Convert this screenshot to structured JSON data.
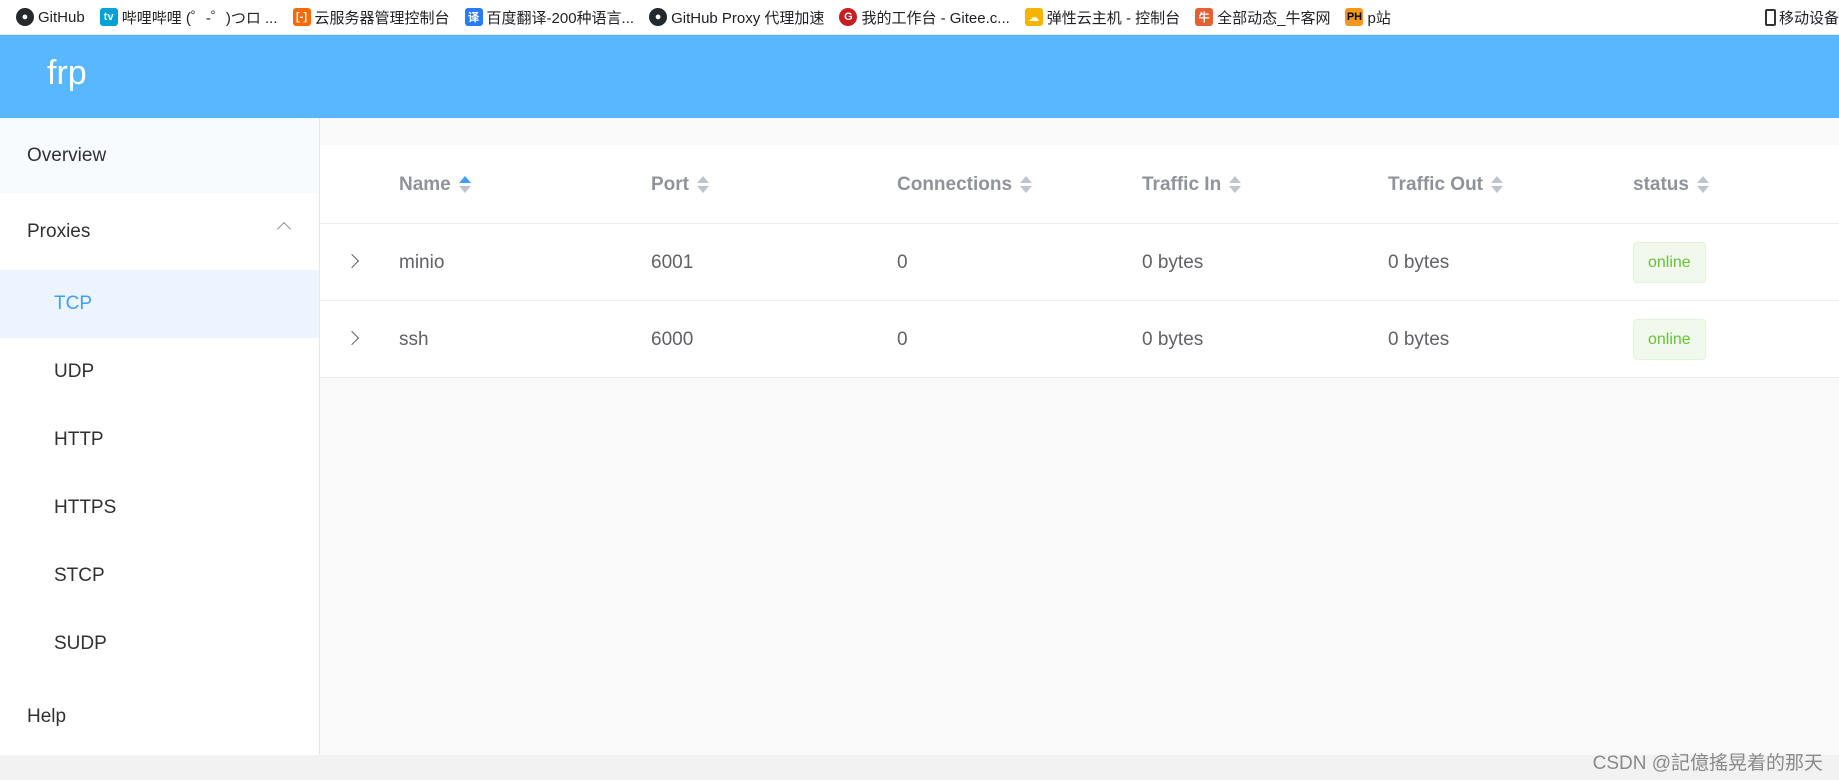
{
  "bookmarks": [
    {
      "label": "GitHub",
      "icon": "github-icon",
      "color": "#24292e"
    },
    {
      "label": "哔哩哔哩 (゜-゜)つロ ...",
      "icon": "bilibili-icon",
      "color": "#00a1d6"
    },
    {
      "label": "云服务器管理控制台",
      "icon": "aliyun-icon",
      "color": "#ff6a00"
    },
    {
      "label": "百度翻译-200种语言...",
      "icon": "baidu-translate-icon",
      "color": "#2a7bf7"
    },
    {
      "label": "GitHub Proxy 代理加速",
      "icon": "github-icon",
      "color": "#24292e"
    },
    {
      "label": "我的工作台 - Gitee.c...",
      "icon": "gitee-icon",
      "color": "#c71d23"
    },
    {
      "label": "弹性云主机 - 控制台",
      "icon": "cloud-icon",
      "color": "#f5b400"
    },
    {
      "label": "全部动态_牛客网",
      "icon": "nowcoder-icon",
      "color": "#e75f35"
    },
    {
      "label": "p站",
      "icon": "ph-icon",
      "color": "#f7971d"
    }
  ],
  "bookmarks_right": {
    "label": "移动设备",
    "icon": "phone-icon"
  },
  "header": {
    "brand": "frp"
  },
  "sidebar": {
    "overview": "Overview",
    "proxies": "Proxies",
    "sub": [
      "TCP",
      "UDP",
      "HTTP",
      "HTTPS",
      "STCP",
      "SUDP"
    ],
    "active": "TCP",
    "help": "Help"
  },
  "table": {
    "columns": [
      "Name",
      "Port",
      "Connections",
      "Traffic In",
      "Traffic Out",
      "status"
    ],
    "sort_active": "Name",
    "rows": [
      {
        "name": "minio",
        "port": "6001",
        "connections": "0",
        "traffic_in": "0 bytes",
        "traffic_out": "0 bytes",
        "status": "online"
      },
      {
        "name": "ssh",
        "port": "6000",
        "connections": "0",
        "traffic_in": "0 bytes",
        "traffic_out": "0 bytes",
        "status": "online"
      }
    ]
  },
  "watermark": "CSDN @記億搖晃着的那天",
  "colors": {
    "header": "#58b7ff",
    "accent": "#409eff",
    "online": "#67c23a"
  }
}
